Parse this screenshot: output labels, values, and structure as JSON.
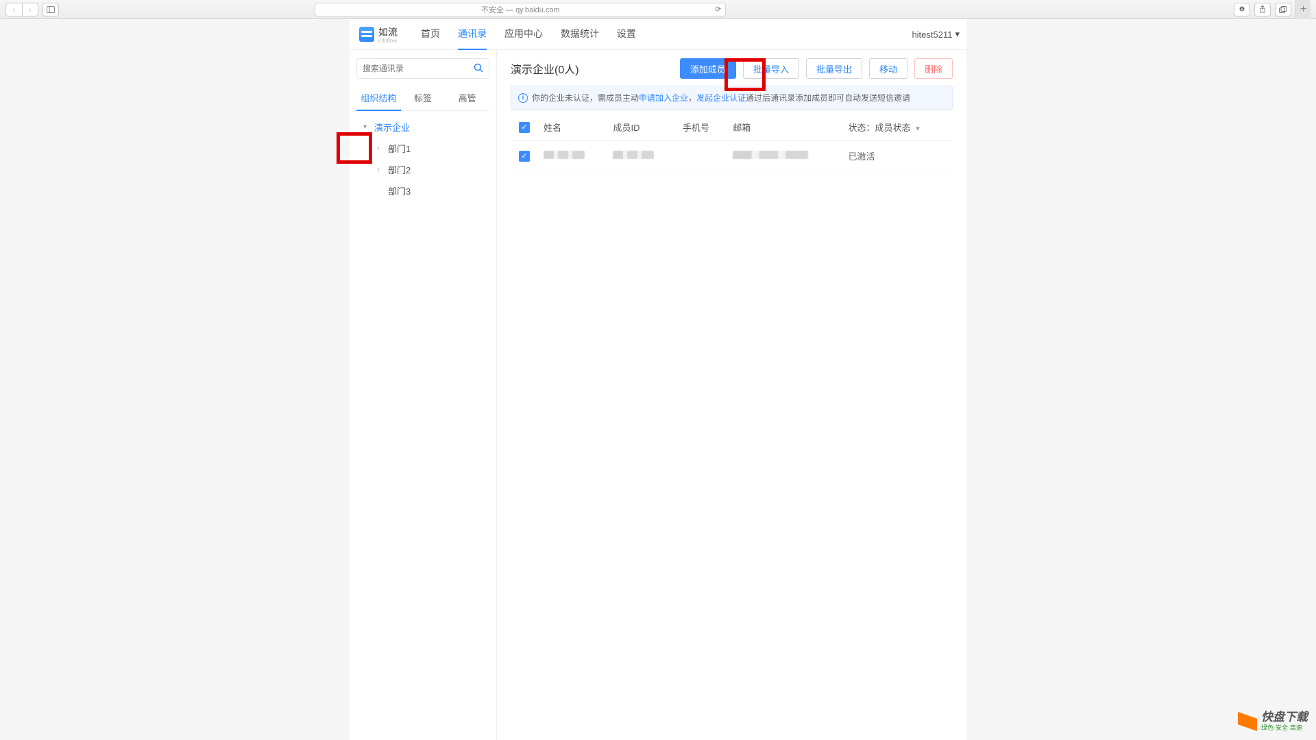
{
  "browser": {
    "url_label": "不安全 — qy.baidu.com"
  },
  "brand": {
    "name": "如流",
    "sub": "infoflow"
  },
  "nav": {
    "items": [
      "首页",
      "通讯录",
      "应用中心",
      "数据统计",
      "设置"
    ],
    "active_index": 1,
    "user": "hitest5211"
  },
  "sidebar": {
    "search_placeholder": "搜索通讯录",
    "tabs": [
      "组织结构",
      "标签",
      "高管"
    ],
    "active_tab": 0,
    "tree": {
      "root": "演示企业",
      "children": [
        "部门1",
        "部门2",
        "部门3"
      ]
    }
  },
  "main": {
    "title": "演示企业(0人)",
    "buttons": {
      "add": "添加成员",
      "import": "批量导入",
      "export": "批量导出",
      "move": "移动",
      "delete": "删除"
    },
    "notice": {
      "prefix": "你的企业未认证，需成员主动",
      "link1": "申请加入企业",
      "sep": "，",
      "link2": "发起企业认证",
      "suffix": "通过后通讯录添加成员即可自动发送短信邀请"
    },
    "columns": {
      "name": "姓名",
      "member_id": "成员ID",
      "phone": "手机号",
      "email": "邮箱",
      "status_label": "状态：",
      "status_filter": "成员状态"
    },
    "row": {
      "status": "已激活"
    }
  },
  "watermark": {
    "title": "快盘下载",
    "sub": "绿色·安全·高速"
  }
}
